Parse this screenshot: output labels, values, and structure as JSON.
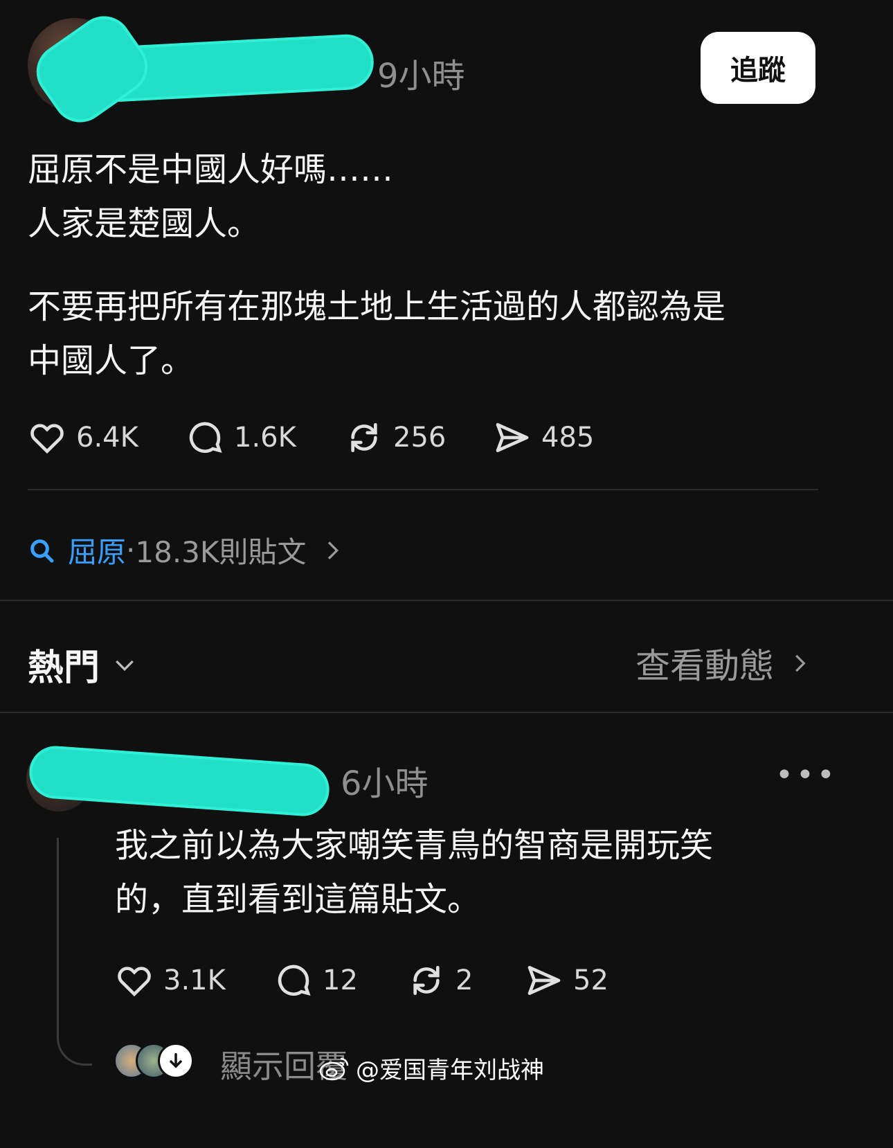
{
  "post": {
    "time": "9小時",
    "follow_label": "追蹤",
    "lines": [
      "屈原不是中國人好嗎……",
      "人家是楚國人。",
      "不要再把所有在那塊土地上生活過的人都認為是",
      "中國人了。"
    ],
    "stats": {
      "likes": "6.4K",
      "comments": "1.6K",
      "reposts": "256",
      "shares": "485"
    }
  },
  "topic": {
    "name": "屈原",
    "separator": " · ",
    "meta": "18.3K則貼文"
  },
  "section": {
    "title": "熱門",
    "view_activity": "查看動態"
  },
  "reply": {
    "time": "6小時",
    "more": "•••",
    "lines": [
      "我之前以為大家嘲笑青鳥的智商是開玩笑",
      "的，直到看到這篇貼文。"
    ],
    "stats": {
      "likes": "3.1K",
      "comments": "12",
      "reposts": "2",
      "shares": "52"
    },
    "show_replies": "顯示回覆"
  },
  "watermark": {
    "text": "@爱国青年刘战神"
  },
  "colors": {
    "background": "#101010",
    "accent_link": "#3aa0ff",
    "redaction": "#22e0c6"
  },
  "icons": [
    "heart-icon",
    "comment-icon",
    "repost-icon",
    "share-icon",
    "search-icon",
    "chevron-right-icon",
    "chevron-down-icon",
    "more-icon",
    "arrow-down-icon",
    "weibo-icon"
  ]
}
